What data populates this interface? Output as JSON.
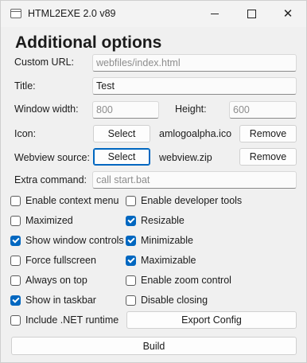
{
  "window": {
    "title": "HTML2EXE 2.0 v89"
  },
  "heading": "Additional options",
  "form": {
    "custom_url_label": "Custom URL:",
    "custom_url_placeholder": "webfiles/index.html",
    "title_label": "Title:",
    "title_value": "Test",
    "window_width_label": "Window width:",
    "window_width_placeholder": "800",
    "height_label": "Height:",
    "height_placeholder": "600",
    "icon_label": "Icon:",
    "icon_select": "Select",
    "icon_file": "amlogoalpha.ico",
    "icon_remove": "Remove",
    "webview_label": "Webview source:",
    "webview_select": "Select",
    "webview_file": "webview.zip",
    "webview_remove": "Remove",
    "extra_label": "Extra command:",
    "extra_placeholder": "call start.bat"
  },
  "checkboxes": {
    "context_menu": {
      "label": "Enable context menu",
      "checked": false
    },
    "dev_tools": {
      "label": "Enable developer tools",
      "checked": false
    },
    "maximized": {
      "label": "Maximized",
      "checked": false
    },
    "resizable": {
      "label": "Resizable",
      "checked": true
    },
    "show_controls": {
      "label": "Show window controls",
      "checked": true
    },
    "minimizable": {
      "label": "Minimizable",
      "checked": true
    },
    "fullscreen": {
      "label": "Force fullscreen",
      "checked": false
    },
    "maximizable": {
      "label": "Maximizable",
      "checked": true
    },
    "always_on_top": {
      "label": "Always on top",
      "checked": false
    },
    "zoom_control": {
      "label": "Enable zoom control",
      "checked": false
    },
    "taskbar": {
      "label": "Show in taskbar",
      "checked": true
    },
    "disable_closing": {
      "label": "Disable closing",
      "checked": false
    },
    "dotnet": {
      "label": "Include .NET runtime",
      "checked": false
    }
  },
  "buttons": {
    "export": "Export Config",
    "build": "Build"
  },
  "colors": {
    "accent": "#0067c0"
  }
}
